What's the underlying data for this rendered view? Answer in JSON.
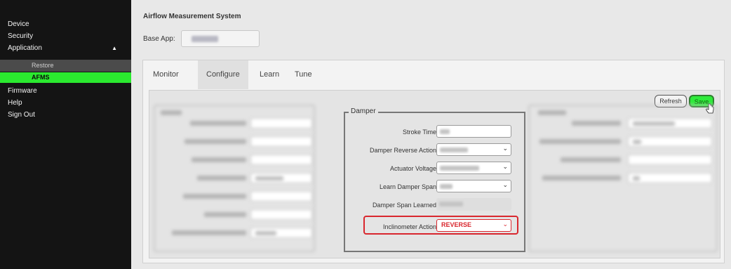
{
  "sidebar": {
    "items": [
      {
        "label": "Device"
      },
      {
        "label": "Security"
      },
      {
        "label": "Application",
        "caret": "▲"
      },
      {
        "label": "Firmware"
      },
      {
        "label": "Help"
      },
      {
        "label": "Sign Out"
      }
    ],
    "subitems": [
      {
        "label": "Restore"
      },
      {
        "label": "AFMS",
        "active": true
      }
    ],
    "active_color": "#2bea2f"
  },
  "header": {
    "title": "Airflow Measurement System",
    "base_app_label": "Base App:"
  },
  "tabs": [
    {
      "label": "Monitor"
    },
    {
      "label": "Configure",
      "active": true
    },
    {
      "label": "Learn"
    },
    {
      "label": "Tune"
    }
  ],
  "toolbar": {
    "refresh_label": "Refresh",
    "save_label": "Save"
  },
  "damper": {
    "legend": "Damper",
    "fields": [
      {
        "label": "Stroke Time"
      },
      {
        "label": "Damper Reverse Action"
      },
      {
        "label": "Actuator Voltage"
      },
      {
        "label": "Learn Damper Span"
      },
      {
        "label": "Damper Span Learned"
      }
    ],
    "inclinometer": {
      "label": "Inclinometer Action",
      "value": "REVERSE",
      "highlight_color": "#d9272e"
    }
  }
}
